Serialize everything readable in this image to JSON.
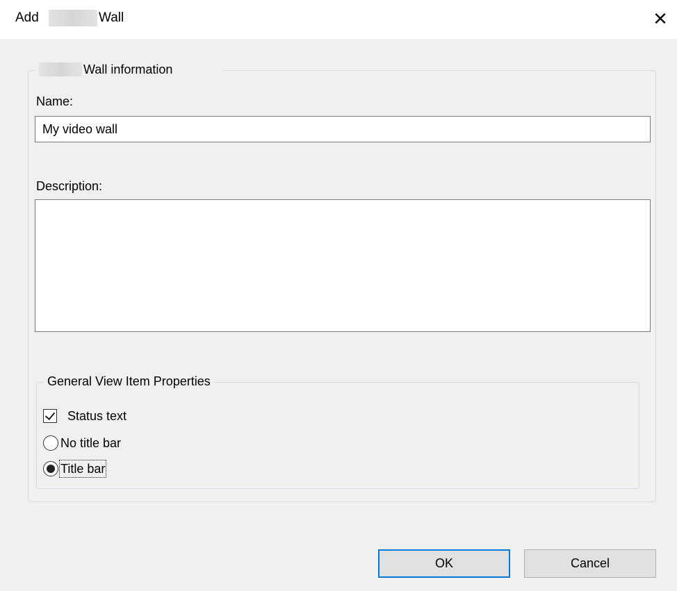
{
  "dialog": {
    "title_prefix": "Add",
    "title_suffix": "Wall",
    "close_glyph": "✕"
  },
  "wall_info": {
    "legend": "Wall information",
    "name_label": "Name:",
    "name_value": "My video wall",
    "description_label": "Description:",
    "description_value": ""
  },
  "view_item_props": {
    "legend": "General View Item Properties",
    "status_text_label": "Status text",
    "status_text_checked": true,
    "title_options": [
      {
        "label": "No title bar",
        "selected": false
      },
      {
        "label": "Title bar",
        "selected": true
      }
    ]
  },
  "buttons": {
    "ok_label": "OK",
    "cancel_label": "Cancel"
  },
  "colors": {
    "dialog_background": "#f0f0f0",
    "focus_border": "#0078d7",
    "group_border": "#d5dbe4"
  },
  "icons": {
    "close": "close-icon",
    "check": "check-mark-icon",
    "radio": "radio-dot-icon"
  }
}
